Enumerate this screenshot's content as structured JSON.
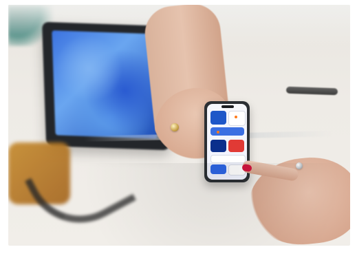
{
  "scene": {
    "kind": "photo",
    "subject": [
      "tablet",
      "smartphone",
      "hands"
    ],
    "colors": {
      "table": "#eeebe6",
      "tablet_frame": "#23262a",
      "tablet_screen": "#3c73e0",
      "phone_frame": "#2b2f33",
      "phone_screen": "#f6f7fb",
      "nail_polish": "#d1153e",
      "accent_blue": "#1e57c8",
      "accent_red": "#e13a35"
    }
  }
}
